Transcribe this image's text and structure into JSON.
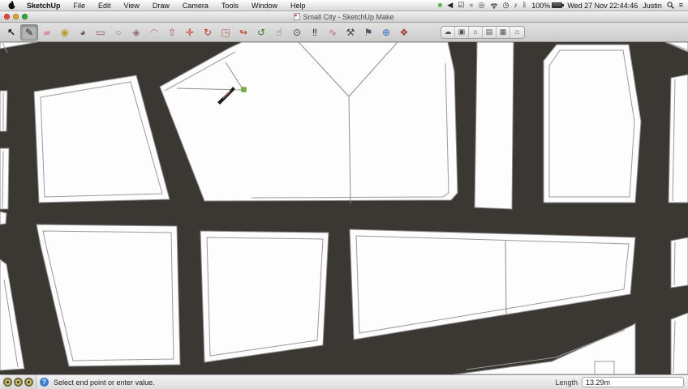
{
  "menu_bar": {
    "items": [
      "SketchUp",
      "File",
      "Edit",
      "View",
      "Draw",
      "Camera",
      "Tools",
      "Window",
      "Help"
    ],
    "status_icons": [
      {
        "name": "app-status-icon",
        "glyph": "■",
        "color": "#56b445"
      },
      {
        "name": "back-arrow-icon",
        "glyph": "◀",
        "color": "#222222"
      },
      {
        "name": "checkbox-icon",
        "glyph": "☑",
        "color": "#222222"
      },
      {
        "name": "dim-circle-icon",
        "glyph": "●",
        "color": "#9b9b9b"
      },
      {
        "name": "target-icon",
        "glyph": "◎",
        "color": "#333333"
      },
      {
        "name": "wifi-icon",
        "glyph": "svg",
        "color": "#222222"
      },
      {
        "name": "time-machine-icon",
        "glyph": "◷",
        "color": "#222222"
      },
      {
        "name": "volume-icon",
        "glyph": "♪",
        "color": "#222222"
      },
      {
        "name": "bluetooth-icon",
        "glyph": "ᛒ",
        "color": "#222222"
      }
    ],
    "battery_percent": "100%",
    "datetime": "Wed 27 Nov 22:44:46",
    "user": "Justin"
  },
  "title_bar": {
    "title": "Small City - SketchUp Make"
  },
  "toolbar": {
    "tools": [
      {
        "name": "select-tool",
        "glyph": "↖",
        "color": "#111111",
        "selected": false,
        "bold": true
      },
      {
        "name": "line-tool",
        "glyph": "✎",
        "color": "#222222",
        "selected": true
      },
      {
        "name": "eraser-tool",
        "glyph": "▰",
        "color": "#d88ea6",
        "selected": false
      },
      {
        "name": "tape-measure-tool",
        "glyph": "◉",
        "color": "#b8a02e",
        "selected": false
      },
      {
        "name": "paint-bucket-tool",
        "glyph": "◕",
        "color": "#6b5140",
        "selected": false
      },
      {
        "name": "rectangle-tool",
        "glyph": "▭",
        "color": "#8a5a5a",
        "selected": false
      },
      {
        "name": "circle-tool",
        "glyph": "○",
        "color": "#7d8a5a",
        "selected": false
      },
      {
        "name": "polygon-tool",
        "glyph": "◈",
        "color": "#9a6565",
        "selected": false
      },
      {
        "name": "arc-tool",
        "glyph": "◠",
        "color": "#c07a8a",
        "selected": false
      },
      {
        "name": "push-pull-tool",
        "glyph": "⇧",
        "color": "#a05a4a",
        "selected": false
      },
      {
        "name": "move-tool",
        "glyph": "✛",
        "color": "#c0392b",
        "selected": false
      },
      {
        "name": "rotate-tool",
        "glyph": "↻",
        "color": "#c0392b",
        "selected": false
      },
      {
        "name": "scale-tool",
        "glyph": "◳",
        "color": "#b0685a",
        "selected": false
      },
      {
        "name": "follow-me-tool",
        "glyph": "↬",
        "color": "#c0392b",
        "selected": false
      },
      {
        "name": "orbit-tool",
        "glyph": "↺",
        "color": "#3a7d2c",
        "selected": false
      },
      {
        "name": "pan-tool",
        "glyph": "☝",
        "color": "#555555",
        "selected": false
      },
      {
        "name": "look-around-tool",
        "glyph": "⊙",
        "color": "#444444",
        "selected": false
      },
      {
        "name": "walk-tool",
        "glyph": "‼",
        "color": "#222222",
        "selected": false
      },
      {
        "name": "freehand-tool",
        "glyph": "∿",
        "color": "#c0607a",
        "selected": false
      },
      {
        "name": "axes-tool",
        "glyph": "⚒",
        "color": "#444444",
        "selected": false
      },
      {
        "name": "text-tool",
        "glyph": "⚑",
        "color": "#555566",
        "selected": false
      },
      {
        "name": "add-location-tool",
        "glyph": "⊕",
        "color": "#2a6bc0",
        "selected": false
      },
      {
        "name": "get-models-tool",
        "glyph": "❖",
        "color": "#a33c3c",
        "selected": false
      }
    ],
    "segmented_buttons": [
      {
        "name": "share-button",
        "glyph": "☁"
      },
      {
        "name": "components-button",
        "glyph": "▣"
      },
      {
        "name": "upload-button",
        "glyph": "⌂"
      },
      {
        "name": "print-button",
        "glyph": "▤"
      },
      {
        "name": "print-alt-button",
        "glyph": "▦"
      },
      {
        "name": "home-button",
        "glyph": "⌂"
      }
    ]
  },
  "canvas": {
    "cursor": "pencil-line-tool-cursor",
    "road_color": "#3b3834",
    "block_color": "#fdfdfd",
    "outline_color": "#8c8c8c",
    "inference_point_color": "#76c043"
  },
  "status_bar": {
    "toggle_count": 3,
    "help_icon": "?",
    "message": "Select end point or enter value.",
    "measurement_label": "Length",
    "measurement_value": "13.29m"
  }
}
